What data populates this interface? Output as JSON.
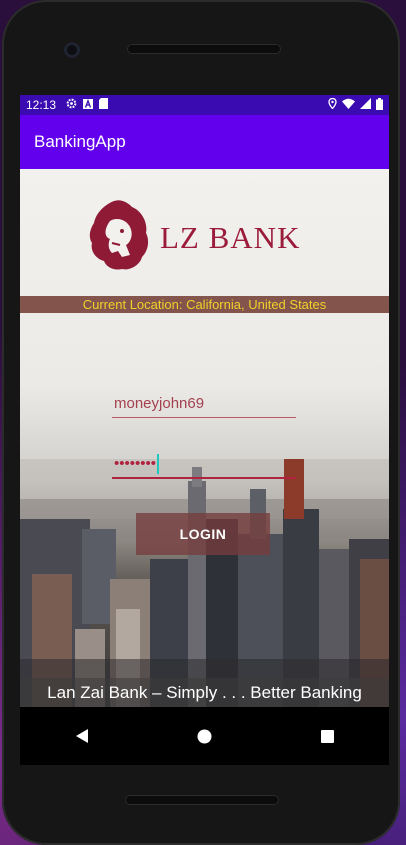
{
  "status_bar": {
    "time": "12:13",
    "left_icons": [
      "gear-icon",
      "font-a-icon",
      "sd-card-icon"
    ],
    "right_icons": [
      "location-icon",
      "wifi-icon",
      "signal-icon",
      "battery-icon"
    ]
  },
  "app_bar": {
    "title": "BankingApp",
    "color": "#6200ee"
  },
  "logo": {
    "text": "LZ BANK",
    "color": "#9b1b3b",
    "icon": "lion-head-icon"
  },
  "location": {
    "text": "Current Location: California, United States",
    "text_color": "#f0d12a"
  },
  "form": {
    "username_value": "moneyjohn69",
    "password_mask": "••••••••",
    "login_label": "LOGIN"
  },
  "tagline": "Lan Zai Bank – Simply . . . Better Banking",
  "nav_bar": {
    "buttons": [
      "back-icon",
      "home-icon",
      "recents-icon"
    ]
  }
}
